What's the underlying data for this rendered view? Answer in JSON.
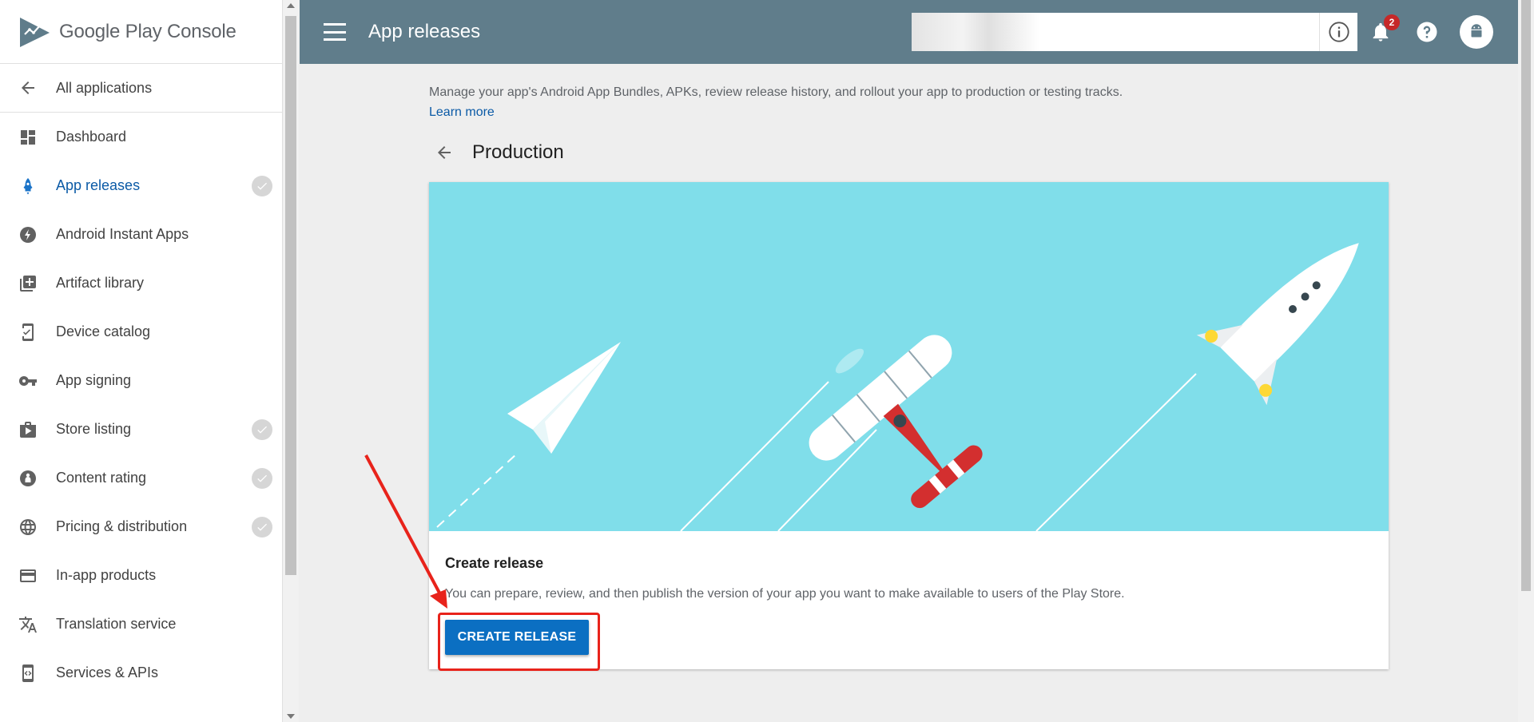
{
  "brand": {
    "google": "Google",
    "play": "Play",
    "console": "Console"
  },
  "sidebar": {
    "back_label": "All applications",
    "items": [
      {
        "label": "Dashboard",
        "icon": "dashboard-icon",
        "checked": false,
        "active": false
      },
      {
        "label": "App releases",
        "icon": "rocket-icon",
        "checked": true,
        "active": true
      },
      {
        "label": "Android Instant Apps",
        "icon": "bolt-icon",
        "checked": false,
        "active": false
      },
      {
        "label": "Artifact library",
        "icon": "library-icon",
        "checked": false,
        "active": false
      },
      {
        "label": "Device catalog",
        "icon": "device-icon",
        "checked": false,
        "active": false
      },
      {
        "label": "App signing",
        "icon": "key-icon",
        "checked": false,
        "active": false
      },
      {
        "label": "Store listing",
        "icon": "store-icon",
        "checked": true,
        "active": false
      },
      {
        "label": "Content rating",
        "icon": "rating-icon",
        "checked": true,
        "active": false
      },
      {
        "label": "Pricing & distribution",
        "icon": "globe-icon",
        "checked": true,
        "active": false
      },
      {
        "label": "In-app products",
        "icon": "card-icon",
        "checked": false,
        "active": false
      },
      {
        "label": "Translation service",
        "icon": "translate-icon",
        "checked": false,
        "active": false
      },
      {
        "label": "Services & APIs",
        "icon": "api-icon",
        "checked": false,
        "active": false
      }
    ]
  },
  "header": {
    "title": "App releases",
    "notification_count": "2"
  },
  "main": {
    "description": "Manage your app's Android App Bundles, APKs, review release history, and rollout your app to production or testing tracks.",
    "learn_more": "Learn more",
    "section_title": "Production",
    "card": {
      "title": "Create release",
      "description": "You can prepare, review, and then publish the version of your app you want to make available to users of the Play Store.",
      "button_label": "CREATE RELEASE"
    }
  },
  "colors": {
    "header_bg": "#607d8b",
    "hero_bg": "#80deea",
    "primary_button": "#0b6fc2",
    "active_nav": "#0b5aa6",
    "annotation": "#e8231b"
  }
}
